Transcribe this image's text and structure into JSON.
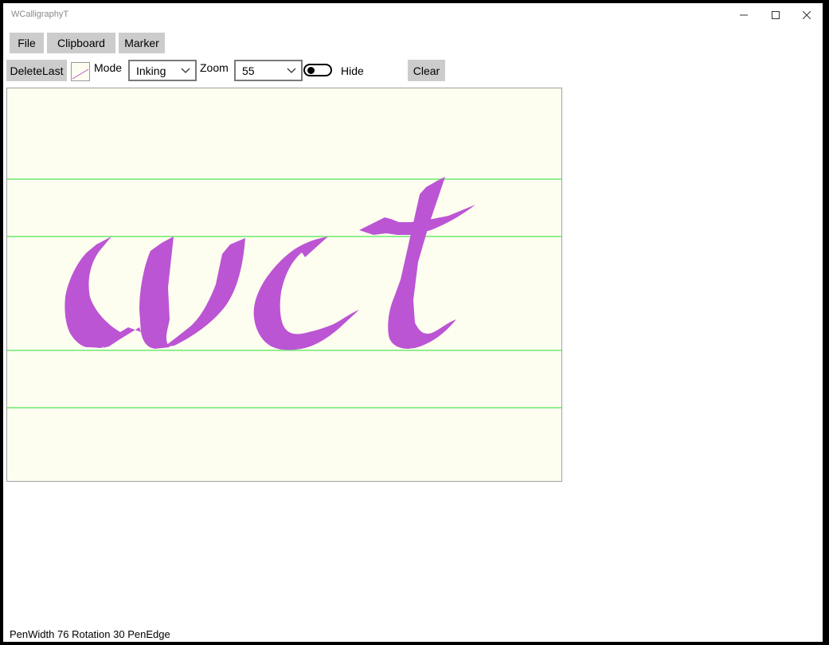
{
  "window": {
    "title": "WCalligraphyT"
  },
  "menu": {
    "file_label": "File",
    "clipboard_label": "Clipboard",
    "marker_label": "Marker"
  },
  "toolbar": {
    "delete_last_label": "DeleteLast",
    "mode_label": "Mode",
    "mode_value": "Inking",
    "zoom_label": "Zoom",
    "zoom_value": "55",
    "hide_label": "Hide",
    "hide_toggle_on": false,
    "clear_label": "Clear"
  },
  "canvas": {
    "background_color": "#fefef0",
    "guide_line_color": "#90ee90",
    "ink_color": "#bb55d4",
    "written_text": "wct"
  },
  "status": {
    "pen_width_label": "PenWidth",
    "pen_width_value": "76",
    "rotation_label": "Rotation",
    "rotation_value": "30",
    "pen_edge_label": "PenEdge"
  },
  "icons": {
    "minimize": "minimize-icon",
    "maximize": "maximize-icon",
    "close": "close-icon",
    "dropdown": "chevron-down-icon",
    "pen_color": "pen-color-swatch-icon"
  }
}
